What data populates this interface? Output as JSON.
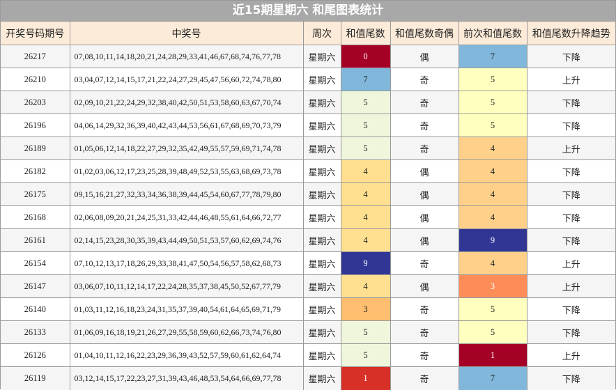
{
  "title": "近15期星期六 和尾图表统计",
  "headers": [
    "开奖号码期号",
    "中奖号",
    "周次",
    "和值尾数",
    "和值尾数奇偶",
    "前次和值尾数",
    "和值尾数升降趋势"
  ],
  "value_colors": {
    "0": {
      "bg": "#a50026",
      "fg": "#ffffff"
    },
    "1": {
      "bg": "#a50026",
      "fg": "#ffffff"
    },
    "1b": {
      "bg": "#d73027",
      "fg": "#ffffff"
    },
    "3": {
      "bg": "#fdbf6f",
      "fg": "#222222"
    },
    "3b": {
      "bg": "#fc8d59",
      "fg": "#ffffff"
    },
    "4": {
      "bg": "#fee090",
      "fg": "#222222"
    },
    "4b": {
      "bg": "#fed08a",
      "fg": "#222222"
    },
    "5": {
      "bg": "#eef6dc",
      "fg": "#222222"
    },
    "5b": {
      "bg": "#ffffbf",
      "fg": "#222222"
    },
    "7": {
      "bg": "#80b7da",
      "fg": "#222222"
    },
    "9": {
      "bg": "#313695",
      "fg": "#ffffff"
    }
  },
  "rows": [
    {
      "issue": "26217",
      "numbers": "07,08,10,11,14,18,20,21,24,28,29,33,41,46,67,68,74,76,77,78",
      "week": "星期六",
      "tail": "0",
      "tail_style": "0",
      "parity": "偶",
      "prev": "7",
      "prev_style": "7",
      "trend": "下降"
    },
    {
      "issue": "26210",
      "numbers": "03,04,07,12,14,15,17,21,22,24,27,29,45,47,56,60,72,74,78,80",
      "week": "星期六",
      "tail": "7",
      "tail_style": "7",
      "parity": "奇",
      "prev": "5",
      "prev_style": "5b",
      "trend": "上升"
    },
    {
      "issue": "26203",
      "numbers": "02,09,10,21,22,24,29,32,38,40,42,50,51,53,58,60,63,67,70,74",
      "week": "星期六",
      "tail": "5",
      "tail_style": "5",
      "parity": "奇",
      "prev": "5",
      "prev_style": "5b",
      "trend": "下降"
    },
    {
      "issue": "26196",
      "numbers": "04,06,14,29,32,36,39,40,42,43,44,53,56,61,67,68,69,70,73,79",
      "week": "星期六",
      "tail": "5",
      "tail_style": "5",
      "parity": "奇",
      "prev": "5",
      "prev_style": "5b",
      "trend": "下降"
    },
    {
      "issue": "26189",
      "numbers": "01,05,06,12,14,18,22,27,29,32,35,42,49,55,57,59,69,71,74,78",
      "week": "星期六",
      "tail": "5",
      "tail_style": "5",
      "parity": "奇",
      "prev": "4",
      "prev_style": "4b",
      "trend": "上升"
    },
    {
      "issue": "26182",
      "numbers": "01,02,03,06,12,17,23,25,28,39,48,49,52,53,55,63,68,69,73,78",
      "week": "星期六",
      "tail": "4",
      "tail_style": "4",
      "parity": "偶",
      "prev": "4",
      "prev_style": "4b",
      "trend": "下降"
    },
    {
      "issue": "26175",
      "numbers": "09,15,16,21,27,32,33,34,36,38,39,44,45,54,60,67,77,78,79,80",
      "week": "星期六",
      "tail": "4",
      "tail_style": "4",
      "parity": "偶",
      "prev": "4",
      "prev_style": "4b",
      "trend": "下降"
    },
    {
      "issue": "26168",
      "numbers": "02,06,08,09,20,21,24,25,31,33,42,44,46,48,55,61,64,66,72,77",
      "week": "星期六",
      "tail": "4",
      "tail_style": "4",
      "parity": "偶",
      "prev": "4",
      "prev_style": "4b",
      "trend": "下降"
    },
    {
      "issue": "26161",
      "numbers": "02,14,15,23,28,30,35,39,43,44,49,50,51,53,57,60,62,69,74,76",
      "week": "星期六",
      "tail": "4",
      "tail_style": "4",
      "parity": "偶",
      "prev": "9",
      "prev_style": "9",
      "trend": "下降"
    },
    {
      "issue": "26154",
      "numbers": "07,10,12,13,17,18,26,29,33,38,41,47,50,54,56,57,58,62,68,73",
      "week": "星期六",
      "tail": "9",
      "tail_style": "9",
      "parity": "奇",
      "prev": "4",
      "prev_style": "4b",
      "trend": "上升"
    },
    {
      "issue": "26147",
      "numbers": "03,06,07,10,11,12,14,17,22,24,28,35,37,38,45,50,52,67,77,79",
      "week": "星期六",
      "tail": "4",
      "tail_style": "4",
      "parity": "偶",
      "prev": "3",
      "prev_style": "3b",
      "trend": "上升"
    },
    {
      "issue": "26140",
      "numbers": "01,03,11,12,16,18,23,24,31,35,37,39,40,54,61,64,65,69,71,79",
      "week": "星期六",
      "tail": "3",
      "tail_style": "3",
      "parity": "奇",
      "prev": "5",
      "prev_style": "5b",
      "trend": "下降"
    },
    {
      "issue": "26133",
      "numbers": "01,06,09,16,18,19,21,26,27,29,55,58,59,60,62,66,73,74,76,80",
      "week": "星期六",
      "tail": "5",
      "tail_style": "5",
      "parity": "奇",
      "prev": "5",
      "prev_style": "5b",
      "trend": "下降"
    },
    {
      "issue": "26126",
      "numbers": "01,04,10,11,12,16,22,23,29,36,39,43,52,57,59,60,61,62,64,74",
      "week": "星期六",
      "tail": "5",
      "tail_style": "5",
      "parity": "奇",
      "prev": "1",
      "prev_style": "1",
      "trend": "上升"
    },
    {
      "issue": "26119",
      "numbers": "03,12,14,15,17,22,23,27,31,39,43,46,48,53,54,64,66,69,77,78",
      "week": "星期六",
      "tail": "1",
      "tail_style": "1b",
      "parity": "奇",
      "prev": "7",
      "prev_style": "7",
      "trend": "下降"
    }
  ]
}
